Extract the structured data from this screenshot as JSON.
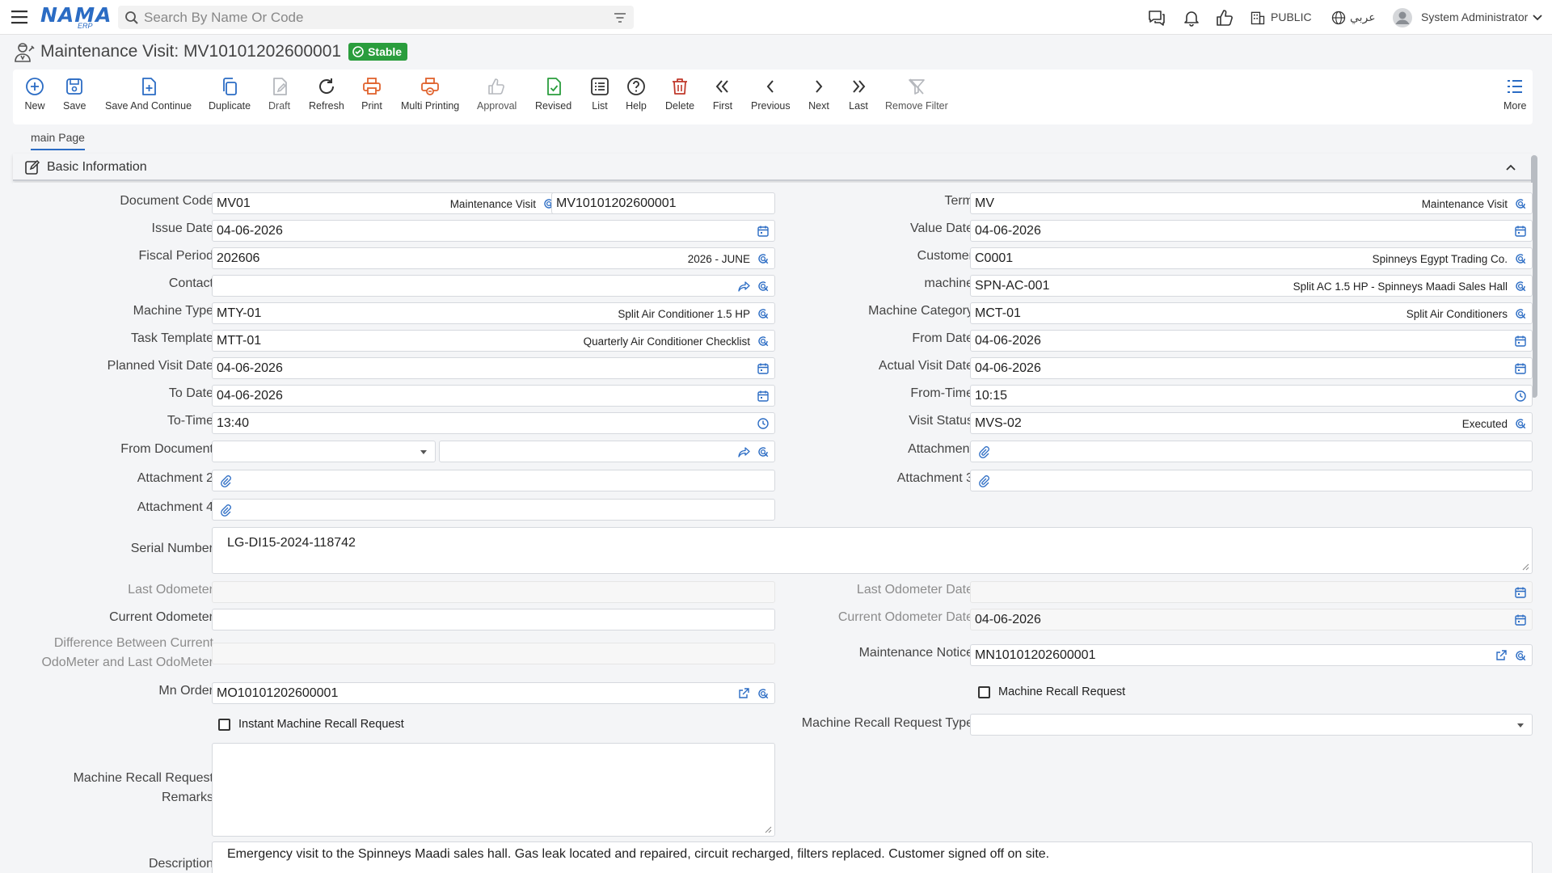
{
  "app": {
    "logo_text": "NAMA",
    "logo_sub": "ERP",
    "search_placeholder": "Search By Name Or Code",
    "company": "PUBLIC",
    "language": "عربي",
    "user": "System Administrator"
  },
  "page": {
    "title": "Maintenance Visit: MV10101202600001",
    "status": "Stable",
    "tab": "main Page",
    "section": "Basic Information"
  },
  "toolbar": {
    "new": "New",
    "save": "Save",
    "save_continue": "Save And Continue",
    "duplicate": "Duplicate",
    "draft": "Draft",
    "refresh": "Refresh",
    "print": "Print",
    "multi_printing": "Multi Printing",
    "approval": "Approval",
    "revised": "Revised",
    "list": "List",
    "help": "Help",
    "delete": "Delete",
    "first": "First",
    "previous": "Previous",
    "next": "Next",
    "last": "Last",
    "remove_filter": "Remove Filter",
    "more": "More"
  },
  "form": {
    "document_code": {
      "label": "Document Code",
      "value": "MV01",
      "desc": "Maintenance Visit",
      "number": "MV10101202600001"
    },
    "term": {
      "label": "Term",
      "value": "MV",
      "desc": "Maintenance Visit"
    },
    "issue_date": {
      "label": "Issue Date",
      "value": "04-06-2026"
    },
    "value_date": {
      "label": "Value Date",
      "value": "04-06-2026"
    },
    "fiscal_period": {
      "label": "Fiscal Period",
      "value": "202606",
      "desc": "2026 - JUNE"
    },
    "customer": {
      "label": "Customer",
      "value": "C0001",
      "desc": "Spinneys Egypt Trading Co."
    },
    "contact": {
      "label": "Contact",
      "value": ""
    },
    "machine": {
      "label": "machine",
      "value": "SPN-AC-001",
      "desc": "Split AC 1.5 HP - Spinneys Maadi Sales Hall"
    },
    "machine_type": {
      "label": "Machine Type",
      "value": "MTY-01",
      "desc": "Split Air Conditioner 1.5 HP"
    },
    "machine_category": {
      "label": "Machine Category",
      "value": "MCT-01",
      "desc": "Split Air Conditioners"
    },
    "task_template": {
      "label": "Task Template",
      "value": "MTT-01",
      "desc": "Quarterly Air Conditioner Checklist"
    },
    "from_date": {
      "label": "From Date",
      "value": "04-06-2026"
    },
    "planned_visit_date": {
      "label": "Planned Visit Date",
      "value": "04-06-2026"
    },
    "actual_visit_date": {
      "label": "Actual Visit Date",
      "value": "04-06-2026"
    },
    "to_date": {
      "label": "To Date",
      "value": "04-06-2026"
    },
    "from_time": {
      "label": "From-Time",
      "value": "10:15"
    },
    "to_time": {
      "label": "To-Time",
      "value": "13:40"
    },
    "visit_status": {
      "label": "Visit Status",
      "value": "MVS-02",
      "desc": "Executed"
    },
    "from_document": {
      "label": "From Document"
    },
    "attachment": {
      "label": "Attachment"
    },
    "attachment2": {
      "label": "Attachment 2"
    },
    "attachment3": {
      "label": "Attachment 3"
    },
    "attachment4": {
      "label": "Attachment 4"
    },
    "serial_number": {
      "label": "Serial Number",
      "value": "LG-DI15-2024-118742"
    },
    "last_odometer": {
      "label": "Last Odometer",
      "value": ""
    },
    "last_odometer_date": {
      "label": "Last Odometer Date",
      "value": ""
    },
    "current_odometer": {
      "label": "Current Odometer",
      "value": ""
    },
    "current_odometer_date": {
      "label": "Current Odometer Date",
      "value": "04-06-2026"
    },
    "difference": {
      "label1": "Difference Between Current",
      "label2": "OdoMeter and Last OdoMeter"
    },
    "maintenance_notice": {
      "label": "Maintenance Notice",
      "value": "MN10101202600001"
    },
    "mn_order": {
      "label": "Mn Order",
      "value": "MO10101202600001"
    },
    "machine_recall_request": {
      "label": "Machine Recall Request",
      "checked": false
    },
    "instant_machine_recall_request": {
      "label": "Instant Machine Recall Request",
      "checked": false
    },
    "machine_recall_request_type": {
      "label": "Machine Recall Request Type"
    },
    "machine_recall_request_remarks": {
      "label1": "Machine Recall Request",
      "label2": "Remarks",
      "value": ""
    },
    "description": {
      "label": "Description",
      "value": "Emergency visit to the Spinneys Maadi sales hall. Gas leak located and repaired, circuit recharged, filters replaced. Customer signed off on site."
    }
  },
  "colors": {
    "accent": "#2b6cc4",
    "status_green": "#2a9d3d",
    "print_orange": "#e0622d",
    "delete_red": "#c0392b",
    "revised_green": "#2a9d3d"
  }
}
